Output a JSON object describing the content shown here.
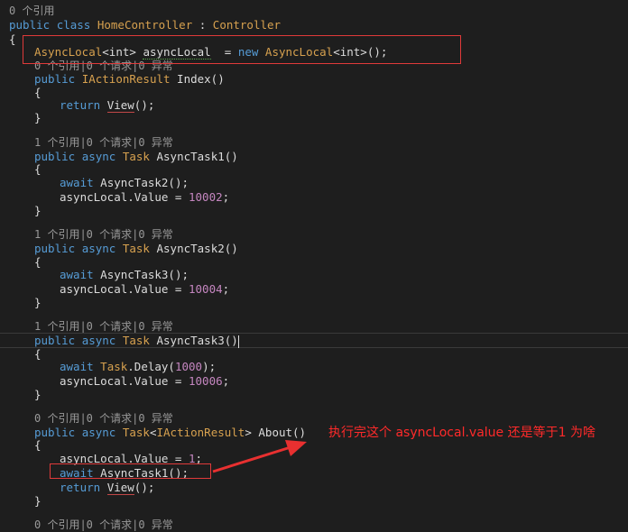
{
  "code": {
    "lens_0": "0 个引用",
    "class_public": "public",
    "class_kw": "class",
    "class_name": "HomeController",
    "class_colon": " : ",
    "class_base": "Controller",
    "brace_open": "{",
    "brace_close": "}",
    "field_type": "AsyncLocal",
    "field_generic": "<int>",
    "field_name": "asyncLocal",
    "field_eq": "  = ",
    "field_new": "new",
    "field_ctor": "AsyncLocal",
    "field_ctor_generic": "<int>",
    "field_end": "();",
    "lens_index": "0 个引用|0 个请求|0 异常",
    "index_sig_a": "public",
    "index_ret": "IActionResult",
    "index_name": " Index()",
    "ret_kw": "return",
    "view_call": "View",
    "view_tail": "();",
    "lens_t1": "1 个引用|0 个请求|0 异常",
    "async_kw": "async",
    "task_ty": "Task",
    "t1_name": " AsyncTask1()",
    "await_kw": "await",
    "t1_body1": " AsyncTask2();",
    "assign_prefix": "asyncLocal.Value = ",
    "t1_val": "10002",
    "semicolon": ";",
    "lens_t2": "1 个引用|0 个请求|0 异常",
    "t2_name": " AsyncTask2()",
    "t2_body1": " AsyncTask3();",
    "t2_val": "10004",
    "lens_t3": "1 个引用|0 个请求|0 异常",
    "t3_name": " AsyncTask3()",
    "t3_delay_pre": ".Delay(",
    "t3_delay_num": "1000",
    "t3_delay_post": ");",
    "t3_val": "10006",
    "lens_about": "0 个引用|0 个请求|0 异常",
    "about_generic_open": "<",
    "about_generic_close": ">",
    "about_name": " About()",
    "about_val": "1",
    "about_call": " AsyncTask1();",
    "lens_bottom": "0 个引用|0 个请求|0 异常"
  },
  "annotation": {
    "text": "执行完这个 asyncLocal.value 还是等于1 为啥",
    "color": "#ff2a2a"
  },
  "colors": {
    "background": "#1e1e1e",
    "keyword": "#569cd6",
    "type": "#4ec9b0",
    "number": "#b5cea8",
    "highlight_box": "#e03a3a"
  }
}
